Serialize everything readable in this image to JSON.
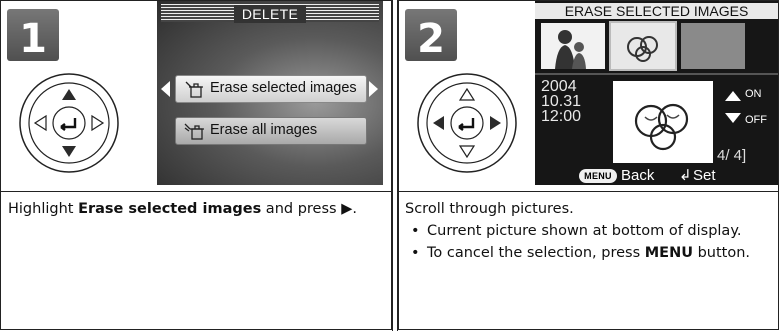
{
  "steps": [
    {
      "number": "1",
      "screen": {
        "title": "DELETE",
        "items": [
          "Erase selected images",
          "Erase all images"
        ]
      },
      "text": {
        "before": "Highlight ",
        "bold": "Erase selected images",
        "middle": " and press ",
        "arrow": "▶",
        "after": "."
      }
    },
    {
      "number": "2",
      "screen": {
        "title": "ERASE SELECTED IMAGES",
        "date": [
          "2004",
          "10.31",
          "12:00"
        ],
        "on_label": "ON",
        "off_label": "OFF",
        "counter": "4/   4]",
        "menu_key": "MENU",
        "back_label": "Back",
        "set_label": "Set"
      },
      "intro": "Scroll through pictures.",
      "bullets": [
        {
          "text": "Current picture shown at bottom of display."
        },
        {
          "before": "To cancel the selection, press ",
          "bold": "MENU",
          "after": " button."
        }
      ]
    }
  ],
  "colors": {
    "badge": "#5e5e5e",
    "screen_dark": "#161616",
    "dpad_arrow": "#2b2b2b"
  }
}
